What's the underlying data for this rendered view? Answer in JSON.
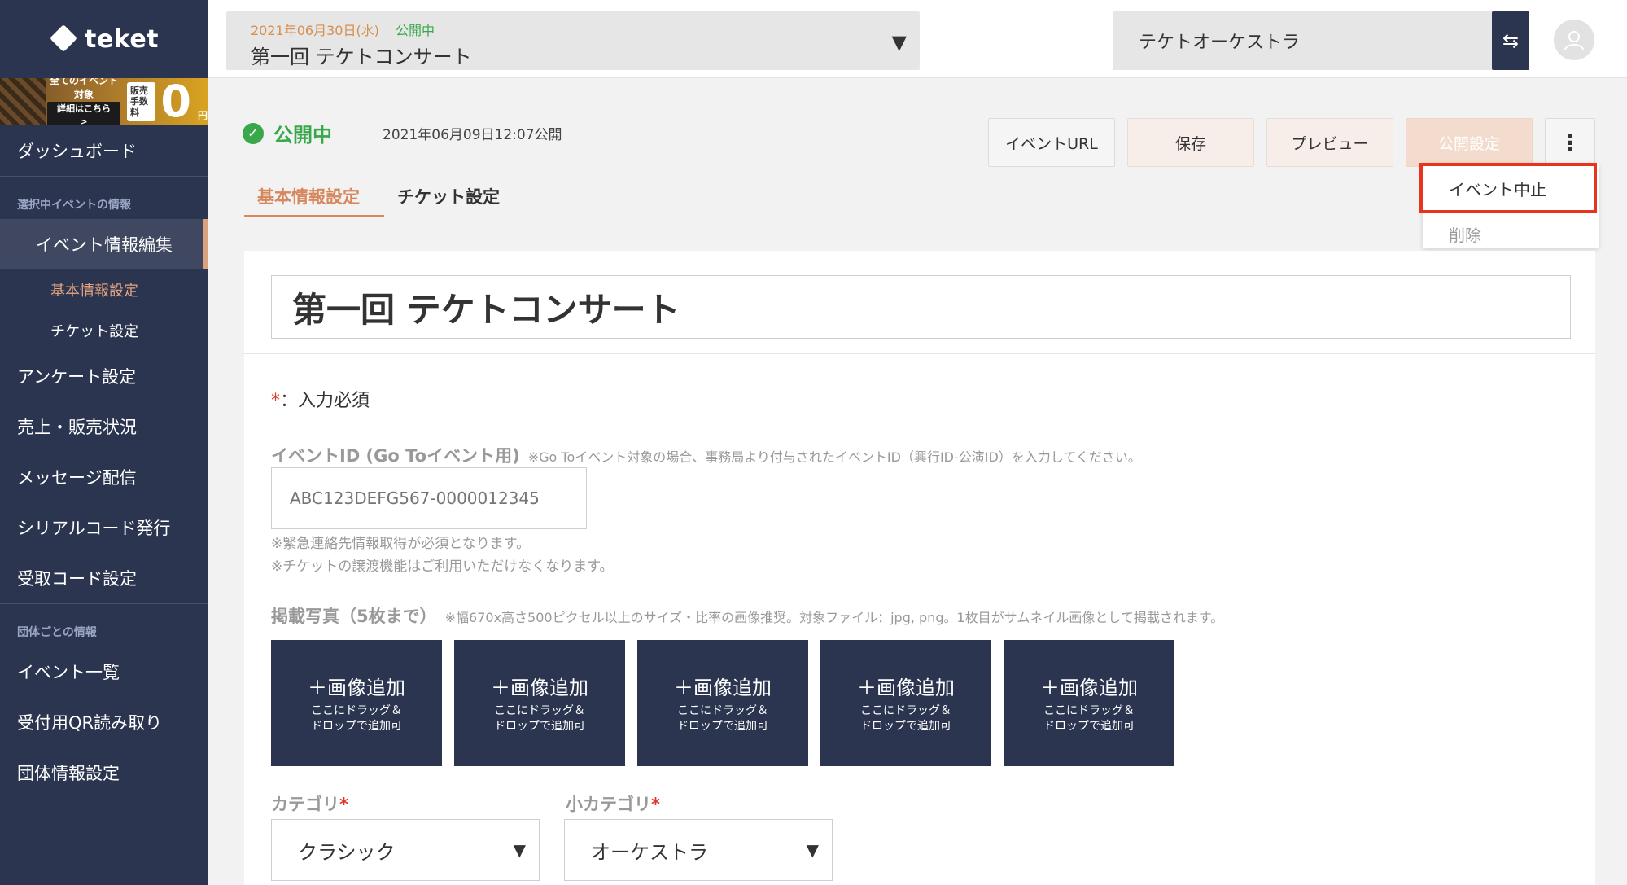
{
  "sidebar": {
    "logo_text": "teket",
    "banner": {
      "line1": "全てのイベント対象",
      "line2": "詳細はこちら >",
      "fee_line1": "販売",
      "fee_line2": "手数料",
      "zero": "0",
      "yen": "円"
    },
    "dashboard": "ダッシュボード",
    "section_selected": "選択中イベントの情報",
    "event_edit": "イベント情報編集",
    "sub_basic": "基本情報設定",
    "sub_ticket": "チケット設定",
    "items": [
      "アンケート設定",
      "売上・販売状況",
      "メッセージ配信",
      "シリアルコード発行",
      "受取コード設定"
    ],
    "section_org": "団体ごとの情報",
    "org_items": [
      "イベント一覧",
      "受付用QR読み取り",
      "団体情報設定"
    ]
  },
  "topbar": {
    "event_date": "2021年06月30日(水)",
    "event_status": "公開中",
    "event_name": "第一回 テケトコンサート",
    "caret": "▼",
    "org_name": "テケトオーケストラ",
    "switch_icon": "⇆"
  },
  "header": {
    "status_label": "公開中",
    "published_at": "2021年06月09日12:07公開",
    "buttons": {
      "event_url": "イベントURL",
      "save": "保存",
      "preview": "プレビュー",
      "publish_settings": "公開設定",
      "more": "⋮"
    },
    "dropdown": {
      "stop": "イベント中止",
      "delete": "削除"
    },
    "tabs": {
      "basic": "基本情報設定",
      "ticket": "チケット設定"
    }
  },
  "form": {
    "title": "第一回 テケトコンサート",
    "required_star": "*",
    "required_text": "：入力必須",
    "event_id_label": "イベントID (Go Toイベント用)",
    "event_id_note": "※Go Toイベント対象の場合、事務局より付与されたイベントID（興行ID-公演ID）を入力してください。",
    "event_id_placeholder": "ABC123DEFG567-0000012345",
    "note1": "※緊急連絡先情報取得が必須となります。",
    "note2": "※チケットの譲渡機能はご利用いただけなくなります。",
    "photos_label": "掲載写真（5枚まで）",
    "photos_note": "※幅670x高さ500ピクセル以上のサイズ・比率の画像推奨。対象ファイル：jpg, png。1枚目がサムネイル画像として掲載されます。",
    "add_image": "＋画像追加",
    "add_image_sub1": "ここにドラッグ＆",
    "add_image_sub2": "ドロップで追加可",
    "category_label": "カテゴリ",
    "subcategory_label": "小カテゴリ",
    "category_value": "クラシック",
    "subcategory_value": "オーケストラ",
    "select_caret": "▼"
  },
  "colors": {
    "sidebar_bg": "#2c3550",
    "accent": "#d7875d",
    "published_green": "#39a84b",
    "highlight_red": "#e8331e"
  }
}
